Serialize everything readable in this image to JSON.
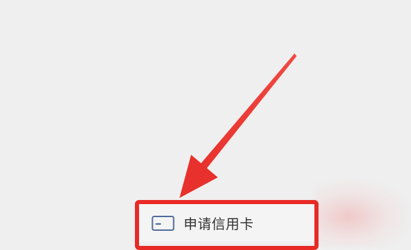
{
  "menu": {
    "credit_card_item": {
      "label": "申请信用卡",
      "icon": "credit-card-icon"
    }
  },
  "annotation": {
    "arrow_color": "#e82a26",
    "highlight_color": "#e82a26"
  }
}
